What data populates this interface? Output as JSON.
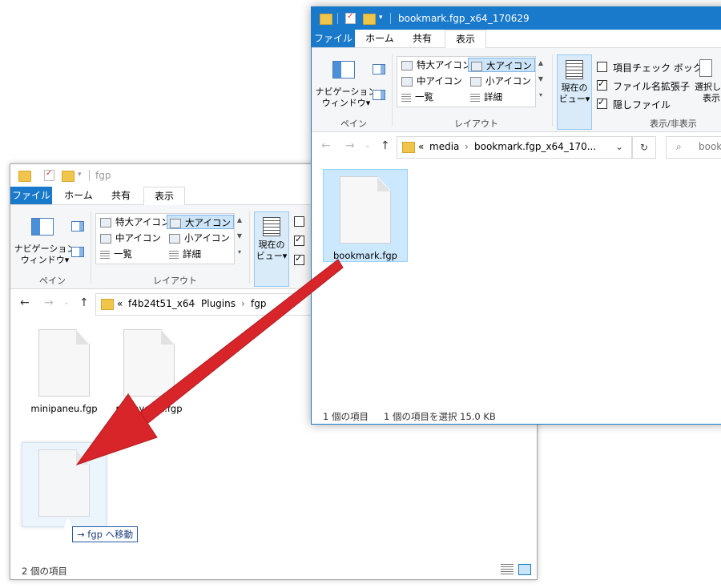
{
  "back_window": {
    "title": "fgp",
    "tabs": [
      "ファイル",
      "ホーム",
      "共有",
      "表示"
    ],
    "ribbon": {
      "nav_pane_line1": "ナビゲーション",
      "nav_pane_line2": "ウィンドウ▾",
      "pane_group": "ペイン",
      "layout_items": [
        "特大アイコン",
        "大アイコン",
        "中アイコン",
        "小アイコン",
        "一覧",
        "詳細"
      ],
      "layout_group": "レイアウト",
      "current_view_line1": "現在の",
      "current_view_line2": "ビュー▾"
    },
    "breadcrumb": [
      "«",
      "f4b24t51_x64",
      "›",
      "Plugins",
      "›",
      "fgp"
    ],
    "files": [
      "minipaneu.fgp",
      "replaygain.fgp"
    ],
    "status": "2 個の項目"
  },
  "front_window": {
    "title": "bookmark.fgp_x64_170629",
    "tabs": [
      "ファイル",
      "ホーム",
      "共有",
      "表示"
    ],
    "ribbon": {
      "nav_pane_line1": "ナビゲーション",
      "nav_pane_line2": "ウィンドウ▾",
      "pane_group": "ペイン",
      "layout_items": [
        "特大アイコン",
        "大アイコン",
        "中アイコン",
        "小アイコン",
        "一覧",
        "詳細"
      ],
      "layout_group": "レイアウト",
      "current_view_line1": "現在の",
      "current_view_line2": "ビュー▾",
      "checkboxes": [
        {
          "label": "項目チェック ボックス",
          "checked": false
        },
        {
          "label": "ファイル名拡張子",
          "checked": true
        },
        {
          "label": "隠しファイル",
          "checked": true
        }
      ],
      "select_partial_line1": "選択し",
      "select_partial_line2": "表示",
      "show_hide_group": "表示/非表示"
    },
    "breadcrumb": [
      "«",
      "media",
      "›",
      "bookmark.fgp_x64_170..."
    ],
    "search_placeholder": "book",
    "files": [
      "bookmark.fgp"
    ],
    "status_count": "1 個の項目",
    "status_selected": "1 個の項目を選択  15.0 KB"
  },
  "drag": {
    "tooltip": "→ fgp へ移動"
  },
  "colors": {
    "accent": "#1979ca",
    "arrow": "#d7252a",
    "selection": "#cce8ff"
  }
}
